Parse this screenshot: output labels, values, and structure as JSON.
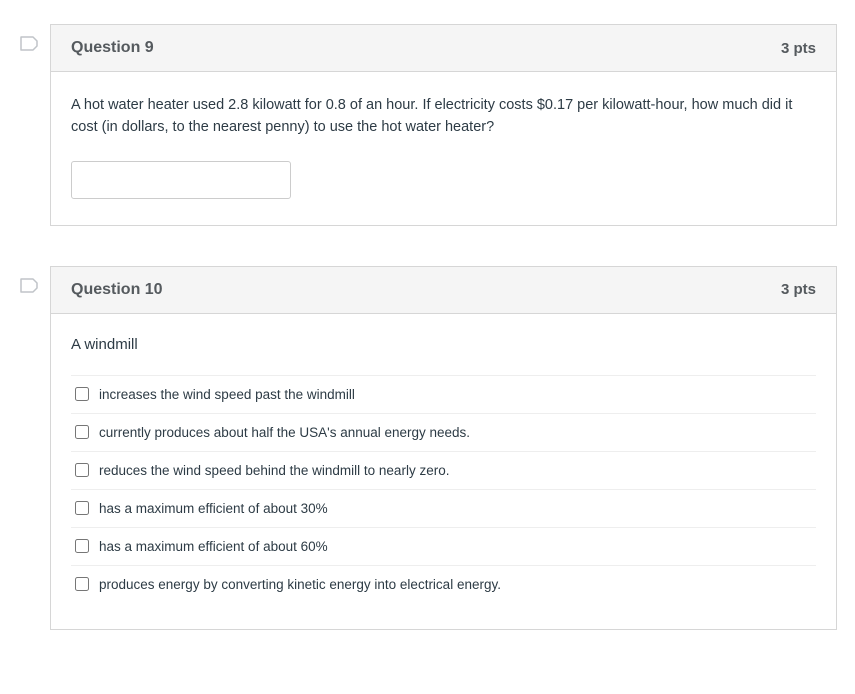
{
  "questions": [
    {
      "title": "Question 9",
      "points": "3 pts",
      "text": "A hot water heater used 2.8 kilowatt for 0.8 of an hour. If electricity costs $0.17 per kilowatt-hour, how much did it cost (in dollars, to the nearest penny) to use the hot water heater?",
      "input_value": ""
    },
    {
      "title": "Question 10",
      "points": "3 pts",
      "prompt": "A windmill",
      "options": [
        "increases the wind speed past the windmill",
        "currently produces about half the USA's annual energy needs.",
        "reduces the wind speed behind the windmill to nearly zero.",
        "has a maximum efficient of about 30%",
        "has a maximum efficient of about 60%",
        "produces energy by converting kinetic energy into electrical energy."
      ]
    }
  ]
}
